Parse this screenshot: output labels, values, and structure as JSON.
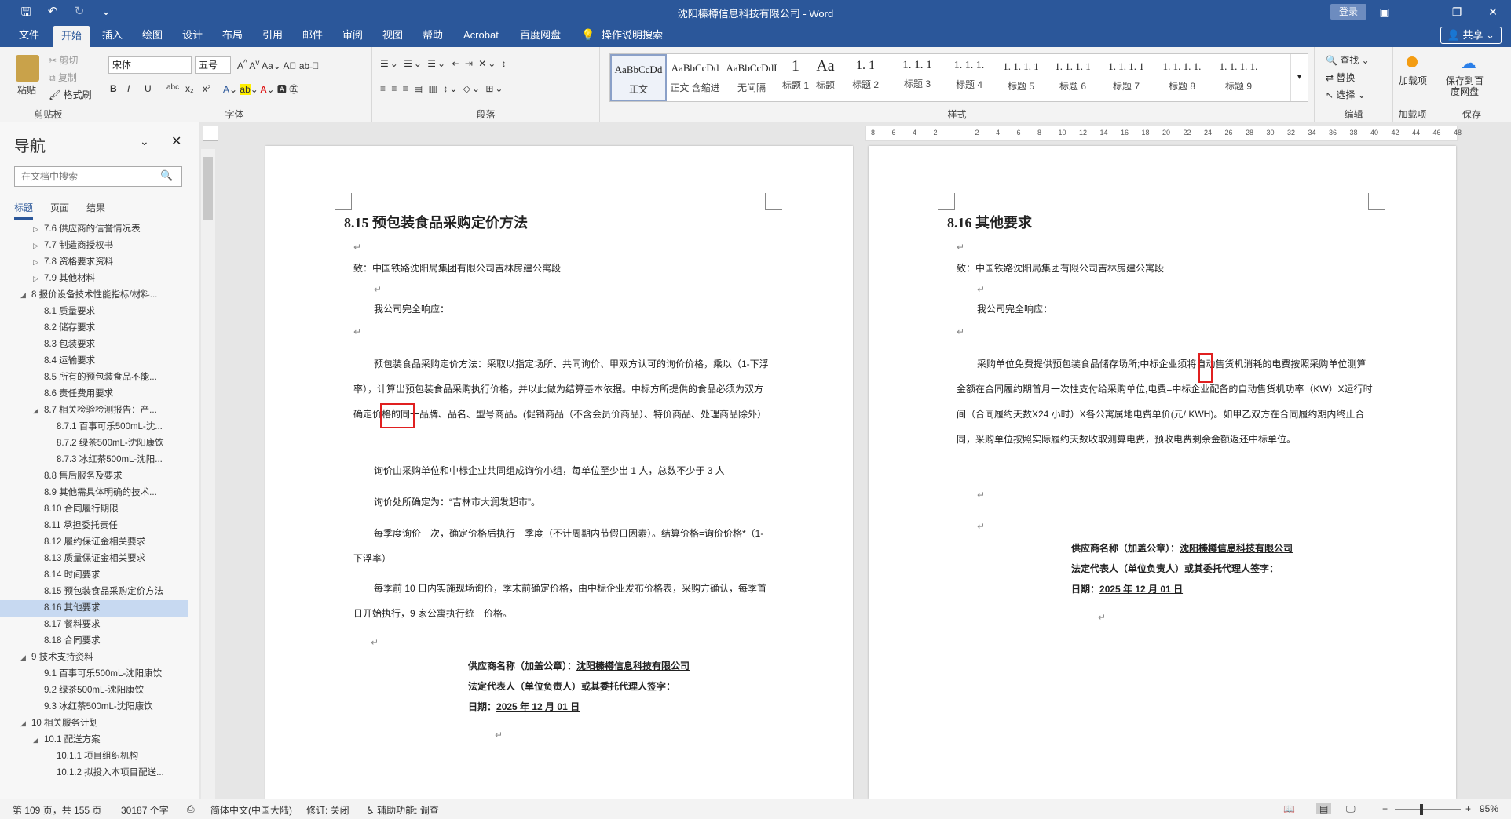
{
  "window": {
    "title": "沈阳榛樽信息科技有限公司 - Word",
    "login": "登录",
    "share": "共享"
  },
  "tabs": [
    "文件",
    "开始",
    "插入",
    "绘图",
    "设计",
    "布局",
    "引用",
    "邮件",
    "审阅",
    "视图",
    "帮助",
    "Acrobat",
    "百度网盘",
    "操作说明搜索"
  ],
  "ribbon": {
    "clipboard": {
      "paste": "粘贴",
      "cut": "剪切",
      "copy": "复制",
      "format_painter": "格式刷",
      "label": "剪贴板"
    },
    "font": {
      "name": "宋体",
      "size": "五号",
      "label": "字体",
      "buttons": [
        "B",
        "I",
        "U",
        "abc",
        "x₂",
        "x²"
      ]
    },
    "paragraph": {
      "label": "段落"
    },
    "styles": {
      "label": "样式",
      "items": [
        {
          "preview": "AaBbCcDd",
          "name": "正文"
        },
        {
          "preview": "AaBbCcDd",
          "name": "正文 含缩进"
        },
        {
          "preview": "AaBbCcDdI",
          "name": "无间隔"
        },
        {
          "preview": "1",
          "name": "标题 1"
        },
        {
          "preview": "Aa",
          "name": "标题"
        },
        {
          "preview": "1. 1",
          "name": "标题 2"
        },
        {
          "preview": "1. 1. 1",
          "name": "标题 3"
        },
        {
          "preview": "1. 1. 1.",
          "name": "标题 4"
        },
        {
          "preview": "1. 1. 1. 1",
          "name": "标题 5"
        },
        {
          "preview": "1. 1. 1. 1",
          "name": "标题 6"
        },
        {
          "preview": "1. 1. 1. 1",
          "name": "标题 7"
        },
        {
          "preview": "1. 1. 1. 1.",
          "name": "标题 8"
        },
        {
          "preview": "1. 1. 1. 1.",
          "name": "标题 9"
        }
      ]
    },
    "editing": {
      "find": "查找",
      "replace": "替换",
      "select": "选择",
      "label": "编辑"
    },
    "addins": {
      "btn": "加载项",
      "label": "加载项"
    },
    "save": {
      "btn": "保存到百度网盘",
      "label": "保存"
    }
  },
  "nav": {
    "title": "导航",
    "search_placeholder": "在文档中搜索",
    "tabs": [
      "标题",
      "页面",
      "结果"
    ],
    "items": [
      {
        "t": "7.6 供应商的信誉情况表",
        "lv": 1,
        "ar": "▷"
      },
      {
        "t": "7.7 制造商授权书",
        "lv": 1,
        "ar": "▷"
      },
      {
        "t": "7.8 资格要求资料",
        "lv": 1,
        "ar": "▷"
      },
      {
        "t": "7.9 其他材料",
        "lv": 1,
        "ar": "▷"
      },
      {
        "t": "8 报价设备技术性能指标/材料...",
        "lv": 0,
        "ar": "◢"
      },
      {
        "t": "8.1 质量要求",
        "lv": 1
      },
      {
        "t": "8.2 储存要求",
        "lv": 1
      },
      {
        "t": "8.3 包装要求",
        "lv": 1
      },
      {
        "t": "8.4 运输要求",
        "lv": 1
      },
      {
        "t": "8.5 所有的预包装食品不能...",
        "lv": 1
      },
      {
        "t": "8.6 责任费用要求",
        "lv": 1
      },
      {
        "t": "8.7 相关检验检测报告：产...",
        "lv": 1,
        "ar": "◢"
      },
      {
        "t": "8.7.1 百事可乐500mL-沈...",
        "lv": 2
      },
      {
        "t": "8.7.2 绿茶500mL-沈阳康饮",
        "lv": 2
      },
      {
        "t": "8.7.3 冰红茶500mL-沈阳...",
        "lv": 2
      },
      {
        "t": "8.8 售后服务及要求",
        "lv": 1
      },
      {
        "t": "8.9 其他需具体明确的技术...",
        "lv": 1
      },
      {
        "t": "8.10 合同履行期限",
        "lv": 1
      },
      {
        "t": "8.11 承担委托责任",
        "lv": 1
      },
      {
        "t": "8.12 履约保证金相关要求",
        "lv": 1
      },
      {
        "t": "8.13 质量保证金相关要求",
        "lv": 1
      },
      {
        "t": "8.14 时间要求",
        "lv": 1
      },
      {
        "t": "8.15 预包装食品采购定价方法",
        "lv": 1
      },
      {
        "t": "8.16 其他要求",
        "lv": 1,
        "sel": true
      },
      {
        "t": "8.17 餐料要求",
        "lv": 1
      },
      {
        "t": "8.18 合同要求",
        "lv": 1
      },
      {
        "t": "9 技术支持资料",
        "lv": 0,
        "ar": "◢"
      },
      {
        "t": "9.1 百事可乐500mL-沈阳康饮",
        "lv": 1
      },
      {
        "t": "9.2 绿茶500mL-沈阳康饮",
        "lv": 1
      },
      {
        "t": "9.3 冰红茶500mL-沈阳康饮",
        "lv": 1
      },
      {
        "t": "10 相关服务计划",
        "lv": 0,
        "ar": "◢"
      },
      {
        "t": "10.1 配送方案",
        "lv": 1,
        "ar": "◢"
      },
      {
        "t": "10.1.1 项目组织机构",
        "lv": 2
      },
      {
        "t": "10.1.2 拟投入本项目配送...",
        "lv": 2
      }
    ]
  },
  "ruler_numbers": [
    "8",
    "6",
    "4",
    "2",
    "",
    "2",
    "4",
    "6",
    "8",
    "10",
    "12",
    "14",
    "16",
    "18",
    "20",
    "22",
    "24",
    "26",
    "28",
    "30",
    "32",
    "34",
    "36",
    "38",
    "40",
    "42",
    "44",
    "46",
    "48"
  ],
  "left_page": {
    "heading": "8.15  预包装食品采购定价方法",
    "to": "致：中国铁路沈阳局集团有限公司吉林房建公寓段",
    "respond": "我公司完全响应：",
    "p1": "预包装食品采购定价方法：采取以指定场所、共同询价、甲双方认可的询价价格，乘以（1-下浮率），计算出预包装食品采购执行价格，并以此做为结算基本依据。中标方所提供的食品必须为双方确定价格的同一品牌、品名、型号商品。(促销商品（不含会员价商品）、特价商品、处理商品除外）",
    "p2": "询价由采购单位和中标企业共同组成询价小组，每单位至少出 1 人，总数不少于 3 人",
    "p3": "询价处所确定为：“吉林市大润发超市”。",
    "p4": "每季度询价一次，确定价格后执行一季度（不计周期内节假日因素）。结算价格=询价价格*（1-下浮率）",
    "p5": "每季前 10 日内实施现场询价，季末前确定价格，由中标企业发布价格表，采购方确认，每季首日开始执行，9 家公寓执行统一价格。",
    "sig1_label": "供应商名称（加盖公章）：",
    "sig1_value": "沈阳榛樽信息科技有限公司",
    "sig2_label": "法定代表人（单位负责人）或其委托代理人签字：",
    "sig3_label": "日期：",
    "sig3_value": "2025 年 12 月 01 日"
  },
  "right_page": {
    "heading": "8.16  其他要求",
    "to": "致：中国铁路沈阳局集团有限公司吉林房建公寓段",
    "respond": "我公司完全响应：",
    "p1": "采购单位免费提供预包装食品储存场所;中标企业须将自动售货机消耗的电费按照采购单位测算金额在合同履约期首月一次性支付给采购单位,电费=中标企业配备的自动售货机功率（KW）X运行时间（合同履约天数X24 小时）X各公寓属地电费单价(元/ KWH)。如甲乙双方在合同履约期内终止合同，采购单位按照实际履约天数收取测算电费，预收电费剩余金额返还中标单位。",
    "sig1_label": "供应商名称（加盖公章）：",
    "sig1_value": "沈阳榛樽信息科技有限公司",
    "sig2_label": "法定代表人（单位负责人）或其委托代理人签字：",
    "sig3_label": "日期：",
    "sig3_value": "2025 年 12 月 01 日"
  },
  "status": {
    "page": "第 109 页，共 155 页",
    "words": "30187 个字",
    "lang": "简体中文(中国大陆)",
    "track": "修订: 关闭",
    "access": "辅助功能: 调查",
    "zoom": "95%"
  }
}
